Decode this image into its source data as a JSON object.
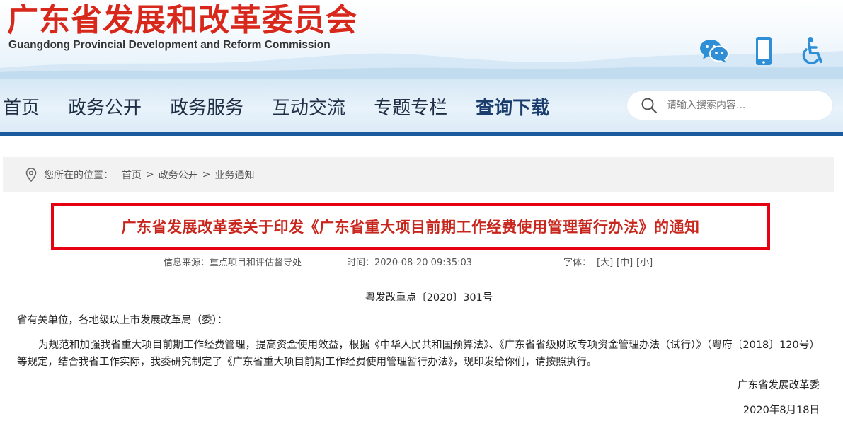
{
  "header": {
    "title_cn": "广东省发展和改革委员会",
    "title_en": "Guangdong Provincial Development and Reform Commission",
    "icons": [
      "wechat-icon",
      "mobile-icon",
      "accessibility-icon"
    ]
  },
  "nav": {
    "items": [
      {
        "label": "首页"
      },
      {
        "label": "政务公开"
      },
      {
        "label": "政务服务"
      },
      {
        "label": "互动交流"
      },
      {
        "label": "专题专栏"
      },
      {
        "label": "查询下载"
      }
    ],
    "active_index": 5
  },
  "search": {
    "placeholder": "请输入搜索内容..."
  },
  "breadcrumb": {
    "label": "您所在的位置：",
    "items": [
      "首页",
      "政务公开",
      "业务通知"
    ],
    "separator": ">"
  },
  "article": {
    "title": "广东省发展改革委关于印发《广东省重大项目前期工作经费使用管理暂行办法》的通知",
    "source": "信息来源：重点项目和评估督导处",
    "time": "时间：2020-08-20 09:35:03",
    "font_label": "字体：",
    "font_sizes": [
      "[大]",
      "[中]",
      "[小]"
    ],
    "doc_number": "粤发改重点〔2020〕301号",
    "addressee": "省有关单位，各地级以上市发展改革局（委）：",
    "body": "为规范和加强我省重大项目前期工作经费管理，提高资金使用效益，根据《中华人民共和国预算法》、《广东省省级财政专项资金管理办法（试行）》（粤府〔2018〕120号）等规定，结合我省工作实际，我委研究制定了《广东省重大项目前期工作经费使用管理暂行办法》，现印发给你们，请按照执行。",
    "signature": "广东省发展改革委",
    "date": "2020年8月18日"
  },
  "colors": {
    "title_red": "#d8271b",
    "nav_line": "#1a5a9c",
    "box_border": "#e60012",
    "icon_blue": "#2f8fd6"
  }
}
